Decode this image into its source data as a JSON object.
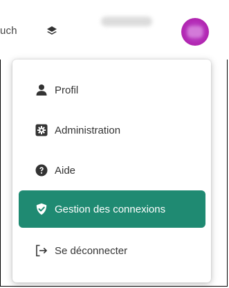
{
  "header": {
    "partial_text": "uch",
    "layers_icon": "layers-icon"
  },
  "user_menu": {
    "items": [
      {
        "label": "Profil",
        "icon": "user-icon"
      },
      {
        "label": "Administration",
        "icon": "gear-icon"
      },
      {
        "label": "Aide",
        "icon": "help-icon"
      },
      {
        "label": "Gestion des connexions",
        "icon": "shield-check-icon",
        "active": true
      },
      {
        "label": "Se déconnecter",
        "icon": "logout-icon"
      }
    ]
  },
  "colors": {
    "active_item_bg": "#1f8a72",
    "avatar": "#b52fb9",
    "icon": "#333333"
  }
}
